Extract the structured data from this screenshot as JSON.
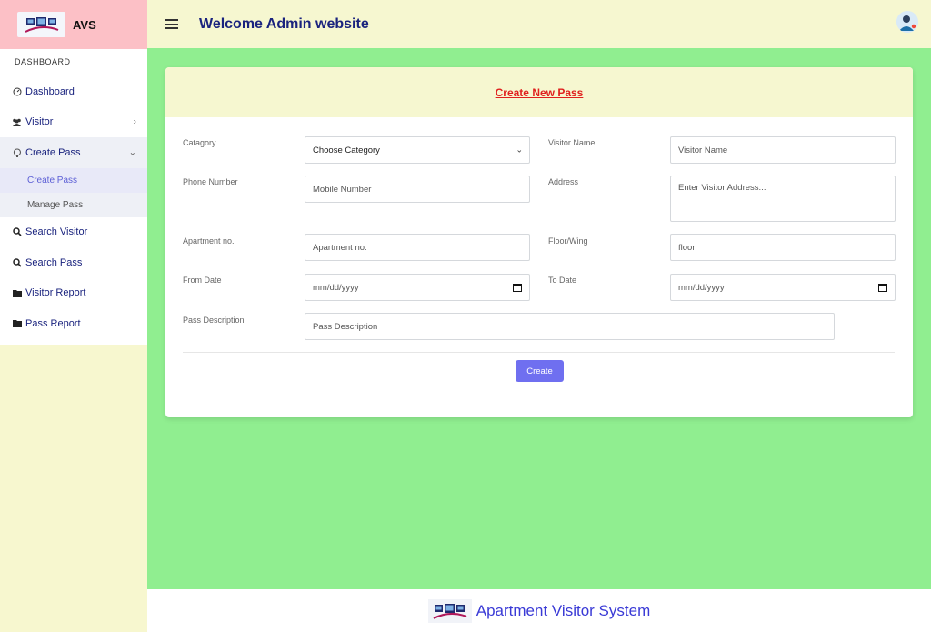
{
  "brand": {
    "name": "AVS"
  },
  "header": {
    "title": "Welcome Admin website"
  },
  "sidebar": {
    "heading": "DASHBOARD",
    "items": [
      {
        "label": "Dashboard",
        "icon": "dashboard-icon"
      },
      {
        "label": "Visitor",
        "icon": "users-icon"
      },
      {
        "label": "Create Pass",
        "icon": "pass-icon"
      },
      {
        "label": "Search Visitor",
        "icon": "search-icon"
      },
      {
        "label": "Search Pass",
        "icon": "search-icon"
      },
      {
        "label": "Visitor Report",
        "icon": "folder-icon"
      },
      {
        "label": "Pass Report",
        "icon": "folder-icon"
      }
    ],
    "subitems": [
      {
        "label": "Create Pass"
      },
      {
        "label": "Manage Pass"
      }
    ]
  },
  "form": {
    "title": "Create New Pass",
    "category": {
      "label": "Catagory",
      "value": "Choose Category"
    },
    "visitor_name": {
      "label": "Visitor Name",
      "placeholder": "Visitor Name"
    },
    "phone": {
      "label": "Phone Number",
      "placeholder": "Mobile Number"
    },
    "address": {
      "label": "Address",
      "placeholder": "Enter Visitor Address..."
    },
    "apartment": {
      "label": "Apartment no.",
      "placeholder": "Apartment no."
    },
    "floor": {
      "label": "Floor/Wing",
      "placeholder": "floor"
    },
    "from_date": {
      "label": "From Date",
      "placeholder": "mm/dd/yyyy"
    },
    "to_date": {
      "label": "To Date",
      "placeholder": "mm/dd/yyyy"
    },
    "description": {
      "label": "Pass Description",
      "placeholder": "Pass Description"
    },
    "submit_label": "Create"
  },
  "footer": {
    "text": "Apartment Visitor System"
  },
  "colors": {
    "title_red": "#e0201e",
    "button": "#6f6ff0",
    "main_bg": "#90ee90",
    "brand_bg": "#fcc0c6"
  }
}
